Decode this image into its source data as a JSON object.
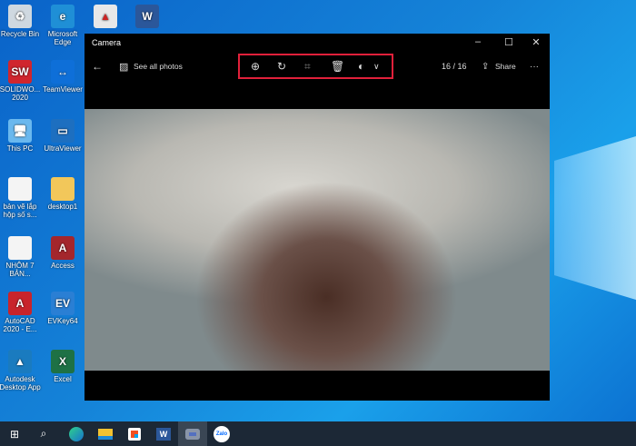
{
  "desktop": {
    "icons": [
      {
        "label": "Recycle Bin",
        "glyph": "♻",
        "color": "#cfd8e0"
      },
      {
        "label": "Microsoft Edge",
        "glyph": "e",
        "color": "#1f8fd6"
      },
      {
        "label": "SOLIDWO... 2020",
        "glyph": "SW",
        "color": "#d0262e"
      },
      {
        "label": "TeamViewer",
        "glyph": "↔",
        "color": "#0e6fd8"
      },
      {
        "label": "This PC",
        "glyph": "🖥",
        "color": "#6ab8ee"
      },
      {
        "label": "UltraViewer",
        "glyph": "▭",
        "color": "#1d6fc0"
      },
      {
        "label": "bản vẽ lắp hộp số s...",
        "glyph": "",
        "color": "#f4f4f4"
      },
      {
        "label": "desktop1",
        "glyph": "",
        "color": "#f2c75a"
      },
      {
        "label": "NHÔM 7 BẢN...",
        "glyph": "",
        "color": "#f4f4f4"
      },
      {
        "label": "Access",
        "glyph": "A",
        "color": "#a4262c"
      },
      {
        "label": "AutoCAD 2020 - E...",
        "glyph": "A",
        "color": "#c8242b"
      },
      {
        "label": "EVKey64",
        "glyph": "EV",
        "color": "#2a7fd4"
      },
      {
        "label": "Autodesk Desktop App",
        "glyph": "▲",
        "color": "#1a7bbf"
      },
      {
        "label": "Excel",
        "glyph": "X",
        "color": "#1e7145"
      }
    ],
    "top_icons": [
      {
        "glyph": "▲",
        "color": "#e8e8e8"
      },
      {
        "glyph": "W",
        "color": "#2b579a"
      }
    ]
  },
  "window": {
    "title": "Camera",
    "see_all": "See all photos",
    "counter": "16 / 16",
    "share": "Share",
    "more": "···"
  },
  "taskbar": {
    "items": [
      "start",
      "search",
      "edge",
      "file-explorer",
      "store",
      "word",
      "camera",
      "zalo"
    ],
    "zalo_label": "Zalo"
  },
  "colors": {
    "highlight": "#e0203a"
  }
}
